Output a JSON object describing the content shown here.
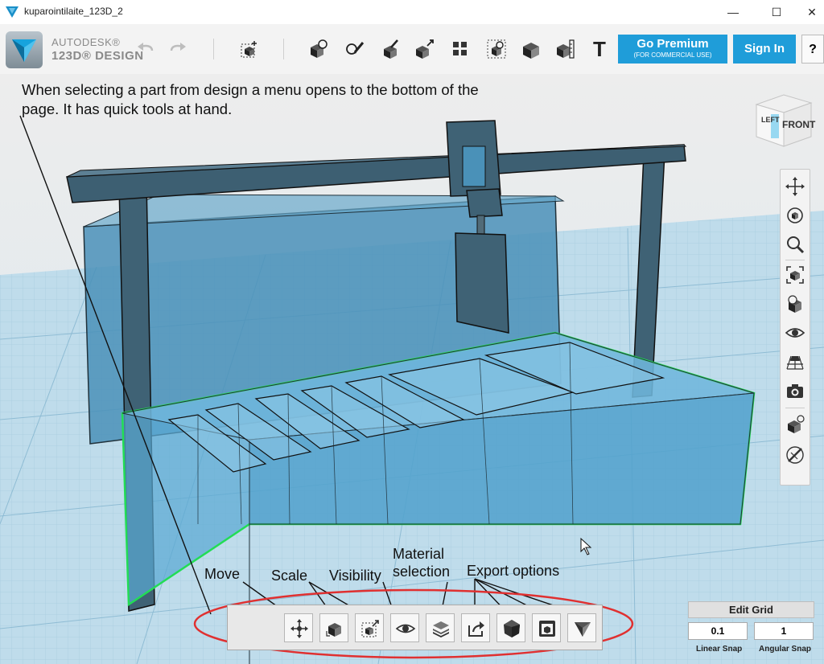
{
  "window": {
    "title": "kuparointilaite_123D_2",
    "minimize_glyph": "—",
    "maximize_glyph": "☐",
    "close_glyph": "✕"
  },
  "toolbar": {
    "brand_line1": "AUTODESK®",
    "brand_line2": "123D® DESIGN",
    "go_premium_label": "Go Premium",
    "go_premium_sub": "(FOR COMMERCIAL USE)",
    "sign_in_label": "Sign In",
    "help_label": "?",
    "text_tool_label": "T"
  },
  "annotation": {
    "note": "When selecting a part from design a menu opens to the bottom of the page. It has quick tools at hand.",
    "labels": {
      "move": "Move",
      "scale": "Scale",
      "visibility": "Visibility",
      "material": "Material selection",
      "export": "Export options"
    }
  },
  "viewcube": {
    "left_label": "LEFT",
    "front_label": "FRONT"
  },
  "edit_grid": {
    "title": "Edit Grid",
    "linear_snap_value": "0.1",
    "angular_snap_value": "1",
    "linear_snap_label": "Linear Snap",
    "angular_snap_label": "Angular Snap"
  },
  "colors": {
    "accent": "#1f9dd9",
    "selection_outline": "#22dd55",
    "annotation_ellipse": "#e03030",
    "part_fill": "#4a9cc6",
    "frame": "#3f6275"
  }
}
